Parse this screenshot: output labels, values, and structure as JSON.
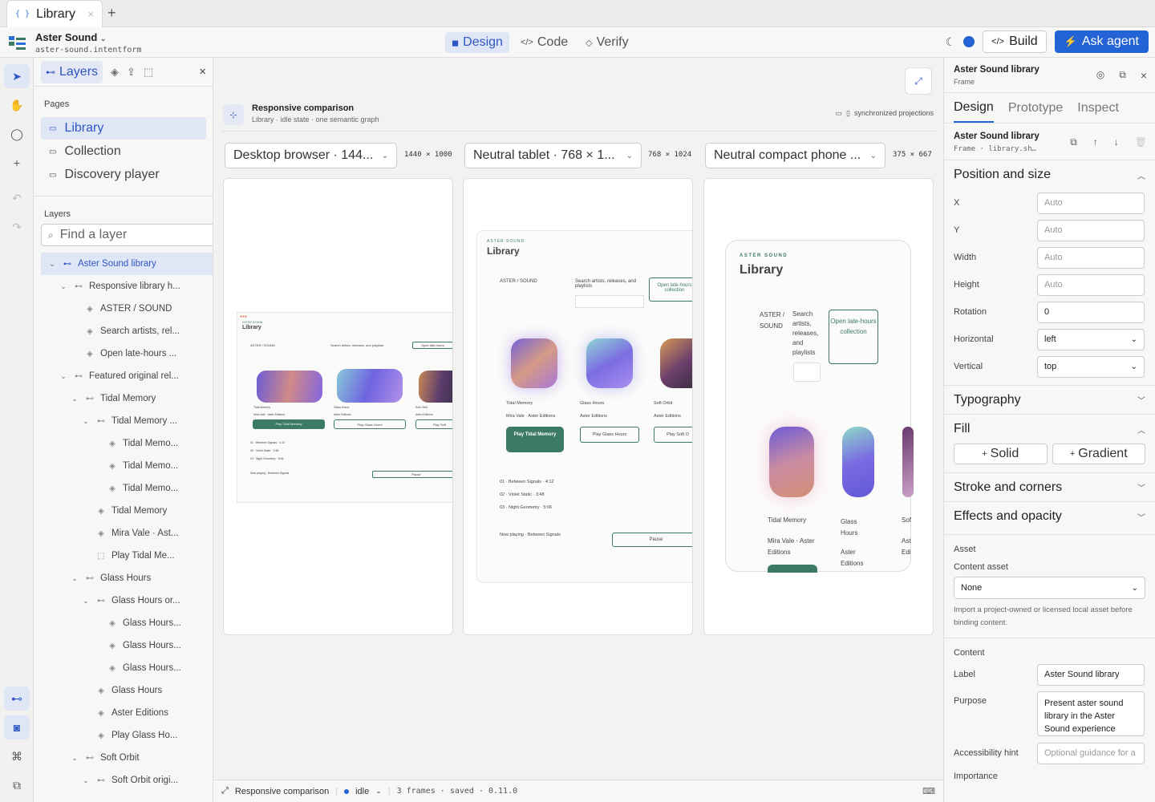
{
  "browser": {
    "tab_title": "Library",
    "tab_icon": "{ }",
    "close": "×",
    "new_tab": "+"
  },
  "project": {
    "name": "Aster Sound",
    "file": "aster-sound.intentform"
  },
  "modes": [
    {
      "label": "Design",
      "icon": "◼",
      "active": true
    },
    {
      "label": "Code",
      "icon": "</>",
      "active": false
    },
    {
      "label": "Verify",
      "icon": "◇",
      "active": false
    }
  ],
  "toolbar": {
    "build_label": "Build",
    "agent_label": "Ask agent",
    "build_icon": "</>",
    "agent_icon": "⚡"
  },
  "left_panel": {
    "tab_layers": "Layers",
    "pages_heading": "Pages",
    "pages": [
      {
        "label": "Library",
        "active": true
      },
      {
        "label": "Collection",
        "active": false
      },
      {
        "label": "Discovery player",
        "active": false
      }
    ],
    "layers_heading": "Layers",
    "search_placeholder": "Find a layer",
    "tree": [
      {
        "label": "Aster Sound library",
        "depth": 0,
        "chev": "v",
        "icon": "frame",
        "selected": true
      },
      {
        "label": "Responsive library h...",
        "depth": 1,
        "chev": "v",
        "icon": "frame"
      },
      {
        "label": "ASTER / SOUND",
        "depth": 2,
        "chev": "",
        "icon": "layer"
      },
      {
        "label": "Search artists, rel...",
        "depth": 2,
        "chev": "",
        "icon": "layer"
      },
      {
        "label": "Open late-hours ...",
        "depth": 2,
        "chev": "",
        "icon": "layer"
      },
      {
        "label": "Featured original rel...",
        "depth": 1,
        "chev": "v",
        "icon": "frame"
      },
      {
        "label": "Tidal Memory",
        "depth": 2,
        "chev": "v",
        "icon": "frame"
      },
      {
        "label": "Tidal Memory ...",
        "depth": 3,
        "chev": "v",
        "icon": "frame"
      },
      {
        "label": "Tidal Memo...",
        "depth": 4,
        "chev": "",
        "icon": "layer"
      },
      {
        "label": "Tidal Memo...",
        "depth": 4,
        "chev": "",
        "icon": "layer"
      },
      {
        "label": "Tidal Memo...",
        "depth": 4,
        "chev": "",
        "icon": "layer"
      },
      {
        "label": "Tidal Memory",
        "depth": 3,
        "chev": "",
        "icon": "layer"
      },
      {
        "label": "Mira Vale · Ast...",
        "depth": 3,
        "chev": "",
        "icon": "layer"
      },
      {
        "label": "Play Tidal Me...",
        "depth": 3,
        "chev": "",
        "icon": "dashed"
      },
      {
        "label": "Glass Hours",
        "depth": 2,
        "chev": "v",
        "icon": "frame"
      },
      {
        "label": "Glass Hours or...",
        "depth": 3,
        "chev": "v",
        "icon": "frame"
      },
      {
        "label": "Glass Hours...",
        "depth": 4,
        "chev": "",
        "icon": "layer"
      },
      {
        "label": "Glass Hours...",
        "depth": 4,
        "chev": "",
        "icon": "layer"
      },
      {
        "label": "Glass Hours...",
        "depth": 4,
        "chev": "",
        "icon": "layer"
      },
      {
        "label": "Glass Hours",
        "depth": 3,
        "chev": "",
        "icon": "layer"
      },
      {
        "label": "Aster Editions",
        "depth": 3,
        "chev": "",
        "icon": "layer"
      },
      {
        "label": "Play Glass Ho...",
        "depth": 3,
        "chev": "",
        "icon": "layer"
      },
      {
        "label": "Soft Orbit",
        "depth": 2,
        "chev": "v",
        "icon": "frame"
      },
      {
        "label": "Soft Orbit origi...",
        "depth": 3,
        "chev": "v",
        "icon": "frame"
      }
    ]
  },
  "canvas": {
    "comparison_title": "Responsive comparison",
    "comparison_sub": "Library · idle state · one semantic graph",
    "sync_label": "synchronized projections",
    "devices": [
      {
        "label": "Desktop browser · 144...",
        "dims": "1440 × 1000"
      },
      {
        "label": "Neutral tablet · 768 × 1...",
        "dims": "768 × 1024"
      },
      {
        "label": "Neutral compact phone ...",
        "dims": "375 × 667"
      }
    ],
    "desktop": {
      "brand": "ASTER SOUND",
      "title": "Library",
      "nav": "ASTER / SOUND",
      "search": "Search artists, releases, and playlists",
      "open_btn": "Open late-hours",
      "cards": [
        {
          "title": "Tidal Memory",
          "sub": "Mira Vale · Aster Editions",
          "btn": "Play Tidal Memory"
        },
        {
          "title": "Glass Hours",
          "sub": "Aster Editions",
          "btn": "Play Glass Hours"
        },
        {
          "title": "Soft Orbit",
          "sub": "Aster Editions",
          "btn": "Play Soft"
        }
      ],
      "tracks": [
        "01 · Between Signals · 4:12",
        "02 · Violet Static · 3:48",
        "03 · Night Geometry · 5:06"
      ],
      "now_playing": "Now playing · Between Signals",
      "pause": "Pause"
    },
    "tablet": {
      "brand": "ASTER SOUND",
      "title": "Library",
      "nav": "ASTER / SOUND",
      "search": "Search artists, releases, and playlists",
      "open_btn": "Open late-hours collection",
      "cards": [
        {
          "title": "Tidal Memory",
          "sub": "Mira Vale · Aster Editions",
          "btn": "Play Tidal Memory"
        },
        {
          "title": "Glass Hours",
          "sub": "Aster Editions",
          "btn": "Play Glass Hours"
        },
        {
          "title": "Soft Orbit",
          "sub": "Aster Editions",
          "btn": "Play Soft O"
        }
      ],
      "tracks": [
        "01 · Between Signals · 4:12",
        "02 · Violet Static · 3:48",
        "03 · Night Geometry · 5:06"
      ],
      "now_playing": "Now playing · Between Signals",
      "pause": "Pause"
    },
    "phone": {
      "brand": "ASTER SOUND",
      "title": "Library",
      "nav": "ASTER / SOUND",
      "search": "Search artists, releases, and playlists",
      "open_btn": "Open late-hours collection",
      "cards": [
        {
          "title": "Tidal Memory",
          "sub": "Mira Vale · Aster Editions"
        },
        {
          "title": "Glass Hours",
          "sub": "Aster Editions"
        },
        {
          "title": "Sof",
          "sub": "Ast Edi"
        }
      ]
    }
  },
  "status": {
    "title": "Responsive comparison",
    "state": "idle",
    "meta": "3 frames · saved · 0.11.0"
  },
  "right_panel": {
    "title": "Aster Sound library",
    "kind": "Frame",
    "tabs": [
      {
        "label": "Design",
        "active": true
      },
      {
        "label": "Prototype",
        "active": false
      },
      {
        "label": "Inspect",
        "active": false
      }
    ],
    "sel_title": "Aster Sound library",
    "sel_path": "Frame · library.sh…",
    "pos_heading": "Position and size",
    "props": [
      {
        "label": "X",
        "value": "Auto",
        "placeholder": true
      },
      {
        "label": "Y",
        "value": "Auto",
        "placeholder": true
      },
      {
        "label": "Width",
        "value": "Auto",
        "placeholder": true
      },
      {
        "label": "Height",
        "value": "Auto",
        "placeholder": true
      },
      {
        "label": "Rotation",
        "value": "0",
        "placeholder": false
      },
      {
        "label": "Horizontal",
        "value": "left",
        "select": true
      },
      {
        "label": "Vertical",
        "value": "top",
        "select": true
      }
    ],
    "typography_heading": "Typography",
    "fill_heading": "Fill",
    "fill_solid": "Solid",
    "fill_gradient": "Gradient",
    "stroke_heading": "Stroke and corners",
    "effects_heading": "Effects and opacity",
    "asset_heading": "Asset",
    "content_asset_label": "Content asset",
    "content_asset_value": "None",
    "asset_note": "Import a project-owned or licensed local asset before binding content.",
    "content_heading": "Content",
    "label_label": "Label",
    "label_value": "Aster Sound library",
    "purpose_label": "Purpose",
    "purpose_value": "Present aster sound library in the Aster Sound experience",
    "a11y_label": "Accessibility hint",
    "a11y_placeholder": "Optional guidance for a",
    "importance_label": "Importance"
  },
  "colors": {
    "accent": "#2463d6",
    "brand_green": "#3d7a64",
    "selected_bg": "#dfe6f6"
  }
}
